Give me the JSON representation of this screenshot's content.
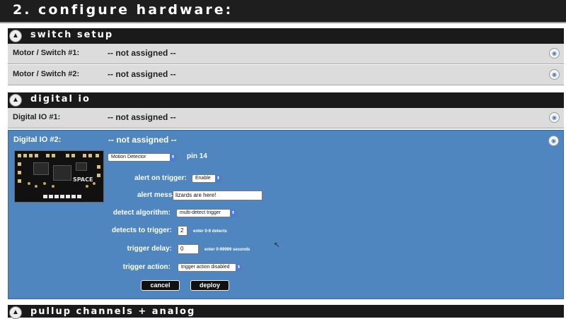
{
  "page": {
    "title": "2. configure hardware:"
  },
  "sections": {
    "switch_setup": {
      "title": "switch setup",
      "rows": [
        {
          "label": "Motor / Switch #1:",
          "value": "-- not assigned --"
        },
        {
          "label": "Motor / Switch #2:",
          "value": "-- not assigned --"
        }
      ]
    },
    "digital_io": {
      "title": "digital io",
      "rows": [
        {
          "label": "Digital IO #1:",
          "value": "-- not assigned --"
        }
      ],
      "panel": {
        "label": "Digital IO #2:",
        "value": "-- not assigned --",
        "board_text": "SPACE",
        "device_select": "Motion Detector",
        "pin": "pin 14",
        "fields": {
          "alert_on_trigger": {
            "label": "alert on trigger:",
            "value": "Enable"
          },
          "alert_message": {
            "label": "alert message:",
            "value": "lizards are here!"
          },
          "detect_algorithm": {
            "label": "detect algorithm:",
            "value": "multi-detect trigger"
          },
          "detects_to_trigger": {
            "label": "detects to trigger:",
            "value": "2",
            "hint": "enter 0-9 detects"
          },
          "trigger_delay": {
            "label": "trigger delay:",
            "value": "0",
            "hint": "enter 0-99999 seconds"
          },
          "trigger_action": {
            "label": "trigger action:",
            "value": "trigger action disabled"
          }
        },
        "buttons": {
          "cancel": "cancel",
          "deploy": "deploy"
        }
      }
    },
    "pullup": {
      "title": "pullup channels + analog"
    }
  },
  "icons": {
    "collapse": "chevron-up-icon",
    "row_action": "edit-circle-icon",
    "dropdown": "dropdown-arrow-icon"
  },
  "colors": {
    "header_bg": "#1e1e1e",
    "row_bg": "#dcdcdc",
    "panel_bg": "#4f86bf",
    "select_arrow": "#4a7ed4"
  }
}
